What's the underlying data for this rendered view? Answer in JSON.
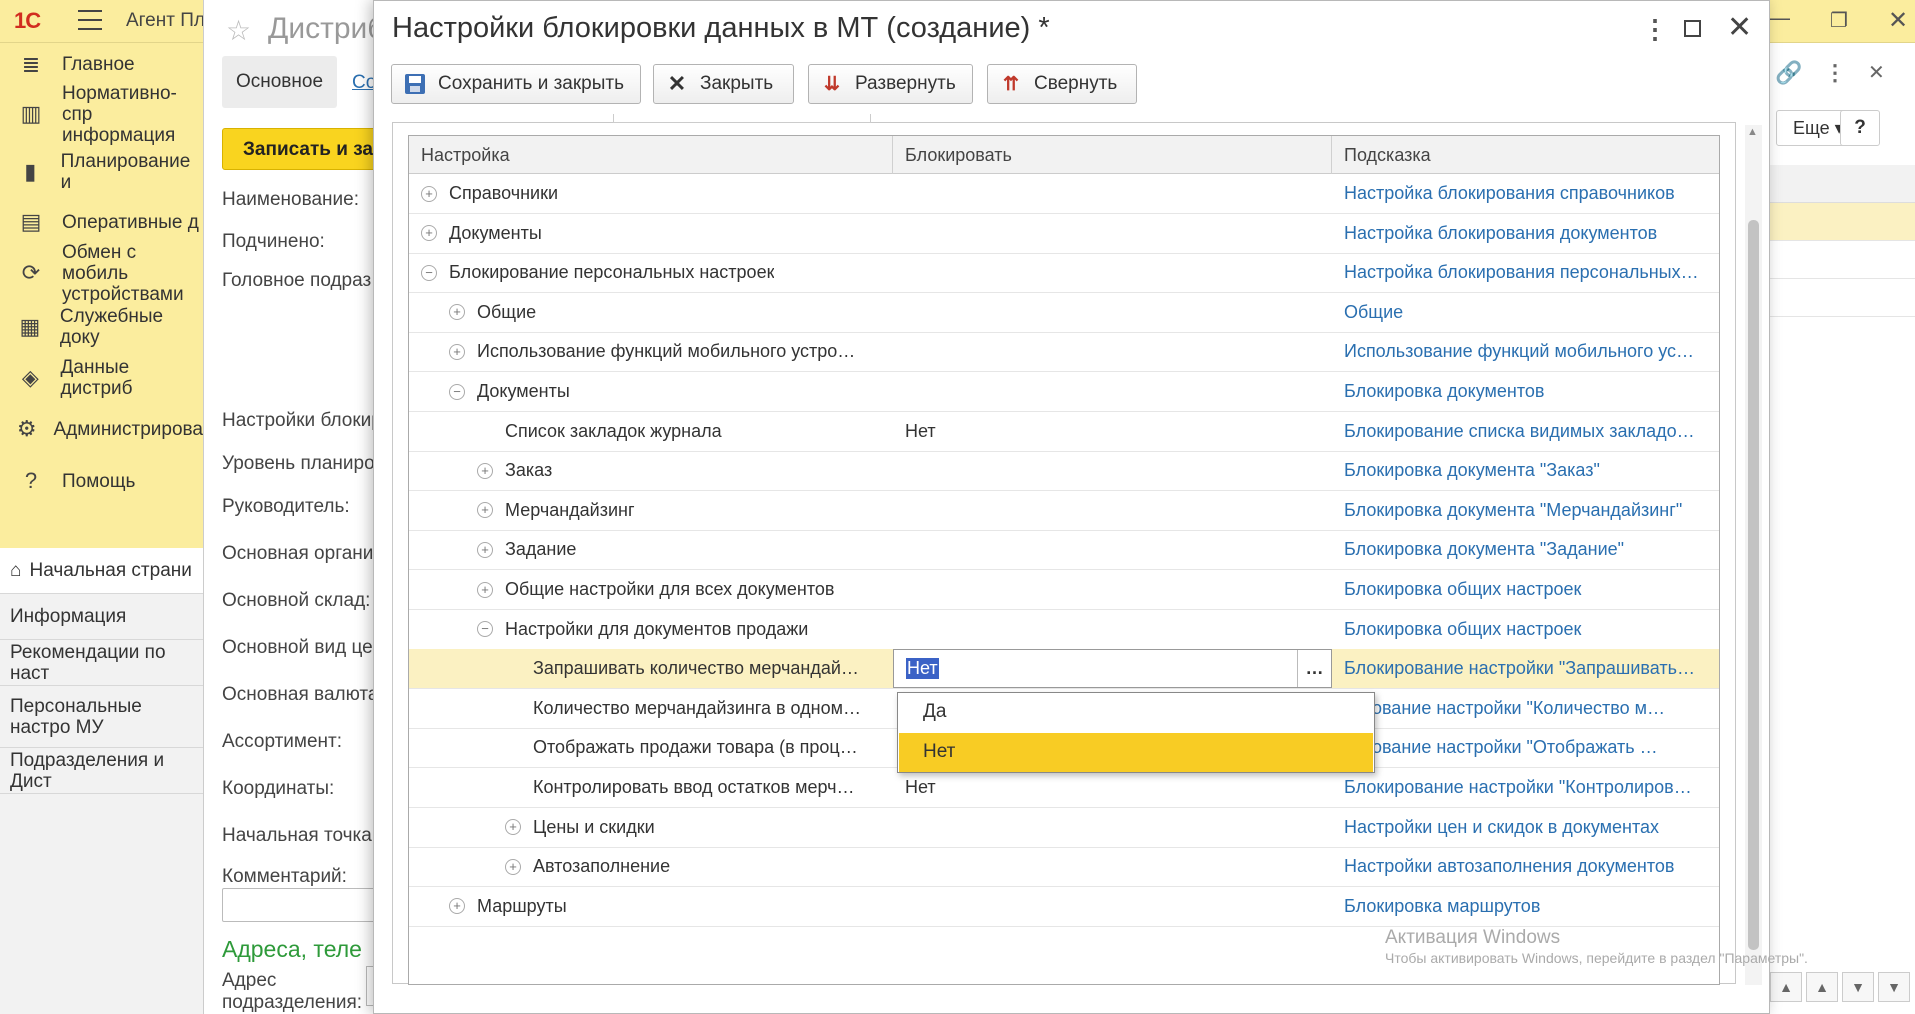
{
  "app": {
    "logo": "1С",
    "title": "Агент Пл",
    "sections": [
      {
        "icon": "≣",
        "icon_name": "menu-lines-icon",
        "label": "Главное"
      },
      {
        "icon": "▥",
        "icon_name": "catalog-icon",
        "label": "Нормативно-спр информация"
      },
      {
        "icon": "▮",
        "icon_name": "chart-icon",
        "label": "Планирование и"
      },
      {
        "icon": "▤",
        "icon_name": "documents-icon",
        "label": "Оперативные д"
      },
      {
        "icon": "⟳",
        "icon_name": "sync-icon",
        "label": "Обмен с мобиль устройствами"
      },
      {
        "icon": "▦",
        "icon_name": "service-docs-icon",
        "label": "Служебные доку"
      },
      {
        "icon": "◈",
        "icon_name": "distributor-data-icon",
        "label": "Данные дистриб"
      },
      {
        "icon": "⚙",
        "icon_name": "gear-icon",
        "label": "Администрирова"
      },
      {
        "icon": "?",
        "icon_name": "help-icon",
        "label": "Помощь"
      }
    ],
    "subnav": [
      {
        "label": "Начальная страни"
      },
      {
        "label": "Информация"
      },
      {
        "label": "Рекомендации по наст"
      },
      {
        "label": "Персональные настро МУ"
      },
      {
        "label": "Подразделения и Дист"
      }
    ]
  },
  "bg_form": {
    "title": "Дистриб",
    "tabs": [
      "Основное",
      "Со"
    ],
    "save_button": "Записать и за",
    "labels": [
      "Наименование:",
      "Подчинено:",
      "Головное подраз",
      "Настройки блокир",
      "Уровень планиро",
      "Руководитель:",
      "Основная органи",
      "Основной склад:",
      "Основной вид це",
      "Основная валюта",
      "Ассортимент:",
      "Координаты:",
      "Начальная точка",
      "Комментарий:"
    ],
    "green_heading": "Адреса, теле",
    "addr_label": "Адрес подразделения:",
    "more_label": "Еще",
    "help_label": "?"
  },
  "modal": {
    "title": "Настройки блокировки данных в МТ (создание) *",
    "toolbar": {
      "save_close": "Сохранить и закрыть",
      "close": "Закрыть",
      "expand": "Развернуть",
      "collapse": "Свернуть"
    },
    "columns": [
      "Настройка",
      "Блокировать",
      "Подсказка"
    ],
    "rows": [
      {
        "level": 0,
        "toggle": "⊕",
        "name": "Справочники",
        "value": "",
        "hint": "Настройка блокирования справочников"
      },
      {
        "level": 0,
        "toggle": "⊕",
        "name": "Документы",
        "value": "",
        "hint": "Настройка блокирования документов"
      },
      {
        "level": 0,
        "toggle": "⊖",
        "name": "Блокирование персональных настроек",
        "value": "",
        "hint": "Настройка блокирования персональных…"
      },
      {
        "level": 1,
        "toggle": "⊕",
        "name": "Общие",
        "value": "",
        "hint": "Общие"
      },
      {
        "level": 1,
        "toggle": "⊕",
        "name": "Использование функций мобильного устро…",
        "value": "",
        "hint": "Использование функций мобильного ус…"
      },
      {
        "level": 1,
        "toggle": "⊖",
        "name": "Документы",
        "value": "",
        "hint": "Блокировка документов"
      },
      {
        "level": 2,
        "toggle": "",
        "name": "Список закладок журнала",
        "value": "Нет",
        "hint": "Блокирование списка видимых закладо…"
      },
      {
        "level": 2,
        "toggle": "⊕",
        "name": "Заказ",
        "value": "",
        "hint": "Блокировка документа \"Заказ\""
      },
      {
        "level": 2,
        "toggle": "⊕",
        "name": "Мерчандайзинг",
        "value": "",
        "hint": "Блокировка документа \"Мерчандайзинг\""
      },
      {
        "level": 2,
        "toggle": "⊕",
        "name": "Задание",
        "value": "",
        "hint": "Блокировка документа \"Задание\""
      },
      {
        "level": 2,
        "toggle": "⊕",
        "name": "Общие настройки для всех документов",
        "value": "",
        "hint": "Блокировка общих настроек"
      },
      {
        "level": 2,
        "toggle": "⊖",
        "name": "Настройки для документов продажи",
        "value": "",
        "hint": "Блокировка общих настроек"
      },
      {
        "level": 3,
        "toggle": "",
        "name": "Запрашивать количество мерчандай…",
        "value": "Нет",
        "hint": "Блокирование настройки \"Запрашивать…",
        "selected": true
      },
      {
        "level": 3,
        "toggle": "",
        "name": "Количество мерчандайзинга в одном…",
        "value": "",
        "hint": "кирование настройки \"Количество м…"
      },
      {
        "level": 3,
        "toggle": "",
        "name": "Отображать продажи товара (в проц…",
        "value": "",
        "hint": "кирование настройки \"Отображать …"
      },
      {
        "level": 3,
        "toggle": "",
        "name": "Контролировать ввод остатков мерч…",
        "value": "Нет",
        "hint": "Блокирование настройки \"Контролиров…"
      },
      {
        "level": 3,
        "toggle": "⊕",
        "name": "Цены и скидки",
        "value": "",
        "hint": "Настройки цен и скидок в документах"
      },
      {
        "level": 3,
        "toggle": "⊕",
        "name": "Автозаполнение",
        "value": "",
        "hint": "Настройки автозаполнения документов"
      },
      {
        "level": 1,
        "toggle": "⊕",
        "name": "Маршруты",
        "value": "",
        "hint": "Блокировка маршрутов"
      }
    ],
    "dropdown": {
      "options": [
        "Да",
        "Нет"
      ],
      "highlighted": "Нет"
    }
  },
  "watermark": {
    "line1": "Активация Windows",
    "line2": "Чтобы активировать Windows, перейдите в раздел \"Параметры\"."
  },
  "colors": {
    "section_bg": "#fbed9e",
    "link": "#2a6fb0",
    "selected_row": "#fbf1c2",
    "dropdown_highlight": "#f8cc24"
  }
}
